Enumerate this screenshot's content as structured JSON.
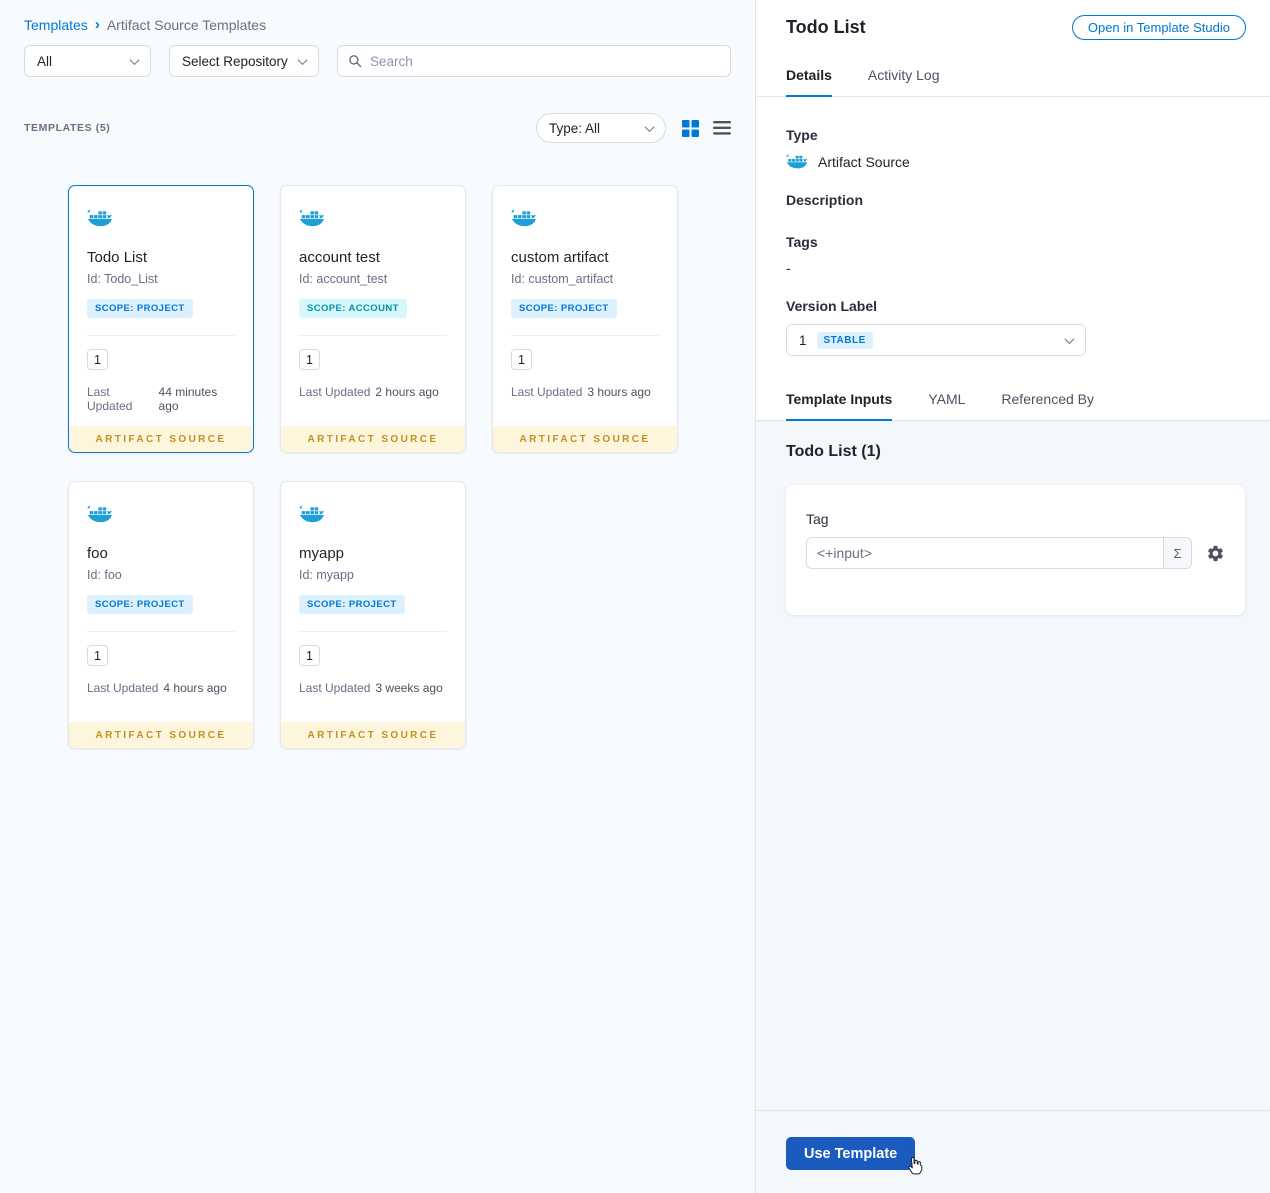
{
  "colors": {
    "primary": "#0278d5",
    "docker_blue": "#1d9fd9",
    "scope_project_bg": "#dcf1fd",
    "scope_project_text": "#0278d5",
    "scope_account_bg": "#d6f7fb",
    "scope_account_text": "#0892a5",
    "footer_bg": "#fdf6dd",
    "footer_text": "#c09022",
    "use_template_bg": "#1b5bc0"
  },
  "breadcrumb": {
    "root": "Templates",
    "separator": "›",
    "current": "Artifact Source Templates"
  },
  "filters": {
    "scope_all": "All",
    "repository": "Select Repository",
    "search_placeholder": "Search"
  },
  "toolbar": {
    "count": "TEMPLATES (5)",
    "type_filter": "Type: All"
  },
  "cards": [
    {
      "title": "Todo List",
      "id": "Id: Todo_List",
      "scope": "SCOPE: PROJECT",
      "version": "1",
      "updated_label": "Last Updated",
      "updated": "44 minutes ago",
      "footer": "ARTIFACT SOURCE"
    },
    {
      "title": "account test",
      "id": "Id: account_test",
      "scope": "SCOPE: ACCOUNT",
      "version": "1",
      "updated_label": "Last Updated",
      "updated": "2 hours ago",
      "footer": "ARTIFACT SOURCE"
    },
    {
      "title": "custom artifact",
      "id": "Id: custom_artifact",
      "scope": "SCOPE: PROJECT",
      "version": "1",
      "updated_label": "Last Updated",
      "updated": "3 hours ago",
      "footer": "ARTIFACT SOURCE"
    },
    {
      "title": "foo",
      "id": "Id: foo",
      "scope": "SCOPE: PROJECT",
      "version": "1",
      "updated_label": "Last Updated",
      "updated": "4 hours ago",
      "footer": "ARTIFACT SOURCE"
    },
    {
      "title": "myapp",
      "id": "Id: myapp",
      "scope": "SCOPE: PROJECT",
      "version": "1",
      "updated_label": "Last Updated",
      "updated": "3 weeks ago",
      "footer": "ARTIFACT SOURCE"
    }
  ],
  "panel": {
    "title": "Todo List",
    "open_button": "Open in Template Studio",
    "tabs": [
      "Details",
      "Activity Log"
    ],
    "fields": {
      "type_label": "Type",
      "type_value": "Artifact Source",
      "description_label": "Description",
      "tags_label": "Tags",
      "tags_value": "-",
      "version_label": "Version Label",
      "version_value": "1",
      "version_badge": "STABLE"
    },
    "inner_tabs": [
      "Template Inputs",
      "YAML",
      "Referenced By"
    ],
    "inputs": {
      "heading": "Todo List (1)",
      "tag_label": "Tag",
      "tag_value": "<+input>",
      "sigma": "Σ"
    },
    "use_template": "Use Template"
  }
}
